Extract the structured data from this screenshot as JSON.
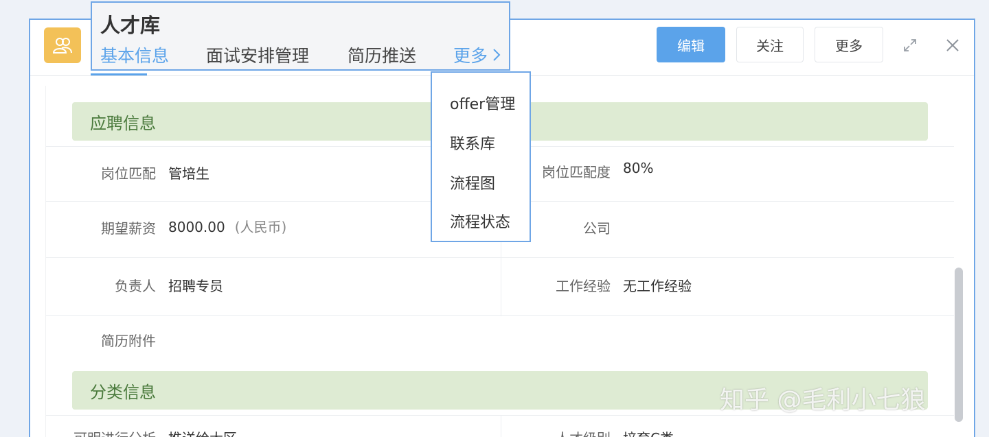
{
  "header": {
    "edit_label": "编辑",
    "follow_label": "关注",
    "more_label": "更多"
  },
  "popup": {
    "title": "人才库",
    "tabs": [
      {
        "label": "基本信息"
      },
      {
        "label": "面试安排管理"
      },
      {
        "label": "简历推送"
      },
      {
        "label": "更多"
      }
    ]
  },
  "dropdown": {
    "items": [
      "offer管理",
      "联系库",
      "流程图",
      "流程状态"
    ]
  },
  "sections": {
    "application": {
      "title": "应聘信息",
      "fields": {
        "position_match": {
          "label": "岗位匹配",
          "value": "管培生"
        },
        "position_match_degree": {
          "label": "岗位匹配度",
          "value": "80%"
        },
        "expected_salary": {
          "label": "期望薪资",
          "value": "8000.00",
          "unit": "(人民币)"
        },
        "company": {
          "label": "公司",
          "value": ""
        },
        "owner": {
          "label": "负责人",
          "value": "招聘专员"
        },
        "work_experience": {
          "label": "工作经验",
          "value": "无工作经验"
        },
        "resume_attachment": {
          "label": "简历附件",
          "value": ""
        }
      }
    },
    "category": {
      "title": "分类信息",
      "fields": {
        "analysis": {
          "label": "可明进行分析",
          "value": "推送给大区"
        },
        "talent_level": {
          "label": "人才级别",
          "value": "培育C类"
        }
      }
    }
  },
  "watermark": "知乎 @毛利小七狼",
  "colors": {
    "accent": "#5ba3ea",
    "section_bg": "#deebd3",
    "section_text": "#4a7a3c",
    "app_icon": "#f3c158"
  },
  "icons": {
    "app": "people-icon",
    "expand": "expand-icon",
    "close": "close-icon",
    "more_chevron": "chevron-right-icon"
  }
}
